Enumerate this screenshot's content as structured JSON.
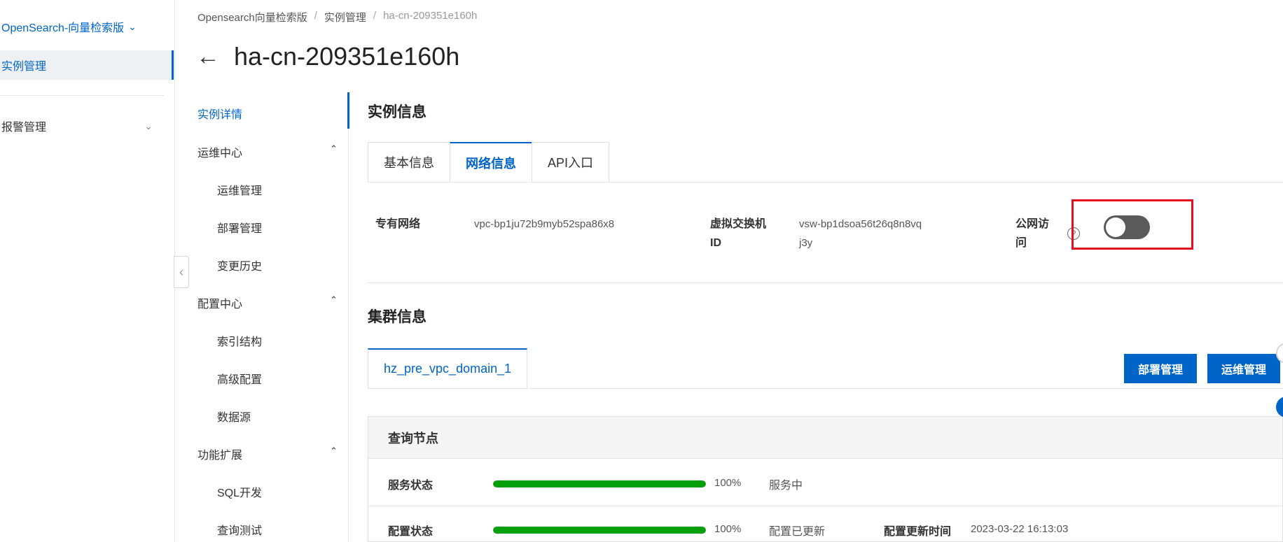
{
  "product": {
    "title": "OpenSearch-向量检索版"
  },
  "nav": {
    "active": "实例管理",
    "alarm": "报警管理"
  },
  "breadcrumb": [
    "Opensearch向量检索版",
    "实例管理",
    "ha-cn-209351e160h"
  ],
  "page_title": "ha-cn-209351e160h",
  "sub_nav": {
    "detail": "实例详情",
    "ops_center": "运维中心",
    "ops_children": [
      "运维管理",
      "部署管理",
      "变更历史"
    ],
    "config_center": "配置中心",
    "config_children": [
      "索引结构",
      "高级配置",
      "数据源"
    ],
    "extensions": "功能扩展",
    "ext_children": [
      "SQL开发",
      "查询测试"
    ]
  },
  "instance_info": {
    "title": "实例信息",
    "tabs": [
      "基本信息",
      "网络信息",
      "API入口"
    ],
    "vpc_label": "专有网络",
    "vpc_value": "vpc-bp1ju72b9myb52spa86x8",
    "vswitch_label_1": "虚拟交换机",
    "vswitch_label_2": "ID",
    "vswitch_value_1": "vsw-bp1dsoa56t26q8n8vq",
    "vswitch_value_2": "j3y",
    "public_label_1": "公网访",
    "public_label_2": "问",
    "help": "?"
  },
  "cluster_info": {
    "title": "集群信息",
    "tab": "hz_pre_vpc_domain_1",
    "deploy_button": "部署管理",
    "ops_button": "运维管理",
    "panel_title": "查询节点",
    "service_status_label": "服务状态",
    "service_progress": 100,
    "service_pct": "100%",
    "service_status": "服务中",
    "config_status_label": "配置状态",
    "config_progress": 100,
    "config_pct": "100%",
    "config_status": "配置已更新",
    "config_time_label": "配置更新时间",
    "config_time": "2023-03-22 16:13:03"
  },
  "colors": {
    "accent": "#0064c8",
    "progress": "#06a00d",
    "highlight": "#e5101e"
  }
}
